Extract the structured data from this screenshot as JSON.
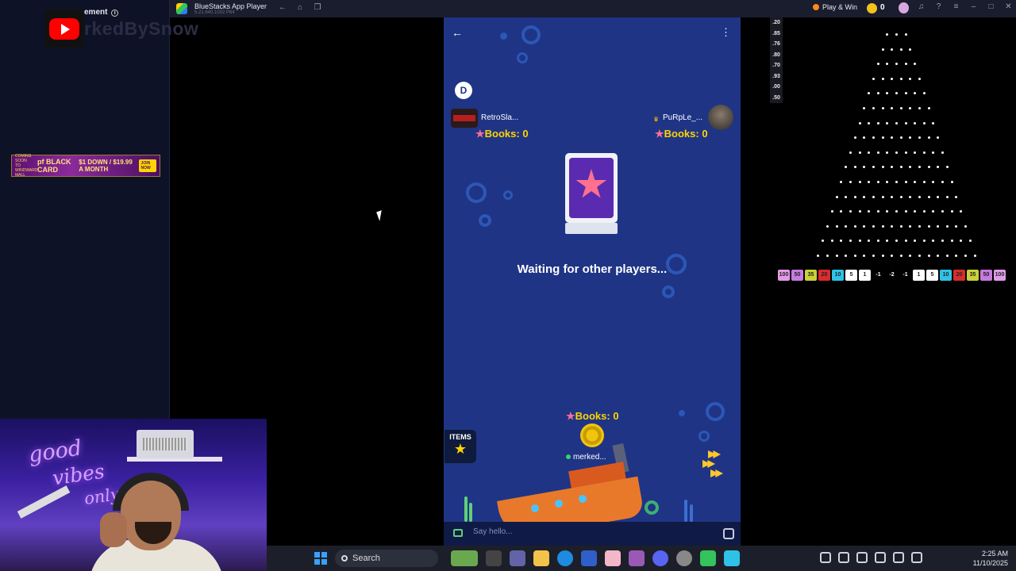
{
  "window": {
    "title": "BlueStacks App Player",
    "version": "5.21.640.1002 P64",
    "play_win_label": "Play & Win",
    "coin_count": "0"
  },
  "stream": {
    "yt_caption": "ement",
    "channel_name": "rkedBySnow",
    "ad": {
      "small": "COMING SOON TO WINDWARD MALL",
      "brand": "pf BLACK CARD",
      "offer": "$1 DOWN / $19.99 A MONTH",
      "cta": "JOIN NOW"
    },
    "webcam_neon": [
      "good",
      "vibes",
      "only"
    ]
  },
  "game": {
    "d_badge": "D",
    "players": [
      {
        "name": "RetroSla...",
        "books": "Books: 0"
      },
      {
        "name": "PuRpLe_...",
        "books": "Books: 0"
      }
    ],
    "waiting_text": "Waiting for other players...",
    "me": {
      "books": "Books: 0",
      "name": "merked..."
    },
    "items_label": "ITEMS",
    "chat_placeholder": "Say hello..."
  },
  "plinko": {
    "odds": [
      ".20",
      ".85",
      ".76",
      ".80",
      ".70",
      ".93",
      ".00",
      ".50"
    ],
    "slots": [
      {
        "label": "100",
        "color": "#e29be8"
      },
      {
        "label": "50",
        "color": "#c77adf"
      },
      {
        "label": "35",
        "color": "#c8d23a"
      },
      {
        "label": "20",
        "color": "#d92c2c"
      },
      {
        "label": "10",
        "color": "#2ec3e6"
      },
      {
        "label": "5",
        "color": "#ffffff"
      },
      {
        "label": "1",
        "color": "#ffffff"
      },
      {
        "label": "-1",
        "color": ""
      },
      {
        "label": "-2",
        "color": ""
      },
      {
        "label": "-1",
        "color": ""
      },
      {
        "label": "1",
        "color": "#ffffff"
      },
      {
        "label": "5",
        "color": "#ffffff"
      },
      {
        "label": "10",
        "color": "#2ec3e6"
      },
      {
        "label": "20",
        "color": "#d92c2c"
      },
      {
        "label": "35",
        "color": "#c8d23a"
      },
      {
        "label": "50",
        "color": "#c77adf"
      },
      {
        "label": "100",
        "color": "#e29be8"
      }
    ]
  },
  "taskbar": {
    "search_label": "Search",
    "time": "2:25 AM",
    "date": "11/10/2025"
  }
}
